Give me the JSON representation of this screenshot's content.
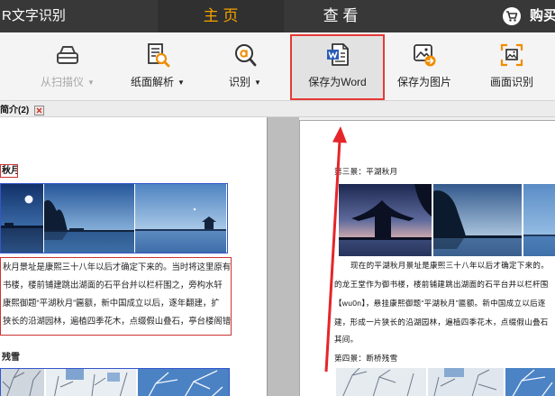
{
  "app": {
    "title": "R文字识别"
  },
  "nav": {
    "tabs": [
      {
        "label": "主 页",
        "active": true
      },
      {
        "label": "查 看",
        "active": false
      }
    ],
    "buy_label": "购买",
    "buy_icon": "cart-icon"
  },
  "toolbar": {
    "items": [
      {
        "label": "从扫描仪",
        "arrow": "▼",
        "icon": "scanner-icon",
        "disabled": true
      },
      {
        "label": "纸面解析",
        "arrow": "▼",
        "icon": "document-analyze-icon"
      },
      {
        "label": "识别",
        "arrow": "▼",
        "icon": "recognize-icon"
      },
      {
        "label": "保存为Word",
        "icon": "word-document-icon",
        "highlighted": true
      },
      {
        "label": "保存为图片",
        "icon": "save-image-icon"
      },
      {
        "label": "画面识别",
        "icon": "screen-recognize-icon"
      }
    ]
  },
  "document_tab": {
    "label": "简介(2)",
    "close_icon": "close-tab-icon"
  },
  "left_page": {
    "heading_1": "秋月",
    "paragraph_lines": [
      "秋月景址是康熙三十八年以后才确定下来的。当时将这里原有",
      "书楼，楼前铺建跳出湖面的石平台并以栏杆围之，旁构水轩",
      "康熙御题“平湖秋月”匾额，新中国成立以后，逐年翻建，扩",
      "狭长的沿湖园林，遍植四季花木，点缀假山叠石，亭台楼阁错落"
    ],
    "heading_2": "残雪"
  },
  "right_page": {
    "heading_1": "第三景：平湖秋月",
    "paragraph_lines": [
      "现在的平湖秋月景址是康熙三十八年以后才确定下来的。",
      "的龙王堂作为御书楼，楼前铺建跳出湖面的石平台并以栏杆围",
      "【wu0n】，悬挂康熙御题“平湖秋月”匾额。新中国成立以后逐",
      "建，形成一片狭长的沿湖园林，遍植四季花木，点缀假山叠石",
      "其间。"
    ],
    "heading_2": "第四景：断桥残雪"
  },
  "annotation": {
    "arrow_icon": "red-arrow-icon"
  },
  "colors": {
    "top_bar": "#383838",
    "active_tab_text": "#f5a200",
    "toolbar_bg": "#f4f4f4",
    "highlight_border": "#e53935",
    "arrow": "#e5252a",
    "icon_accent": "#f08c00",
    "text_region_box": "#cc3333",
    "image_region_box": "#3355cc"
  }
}
